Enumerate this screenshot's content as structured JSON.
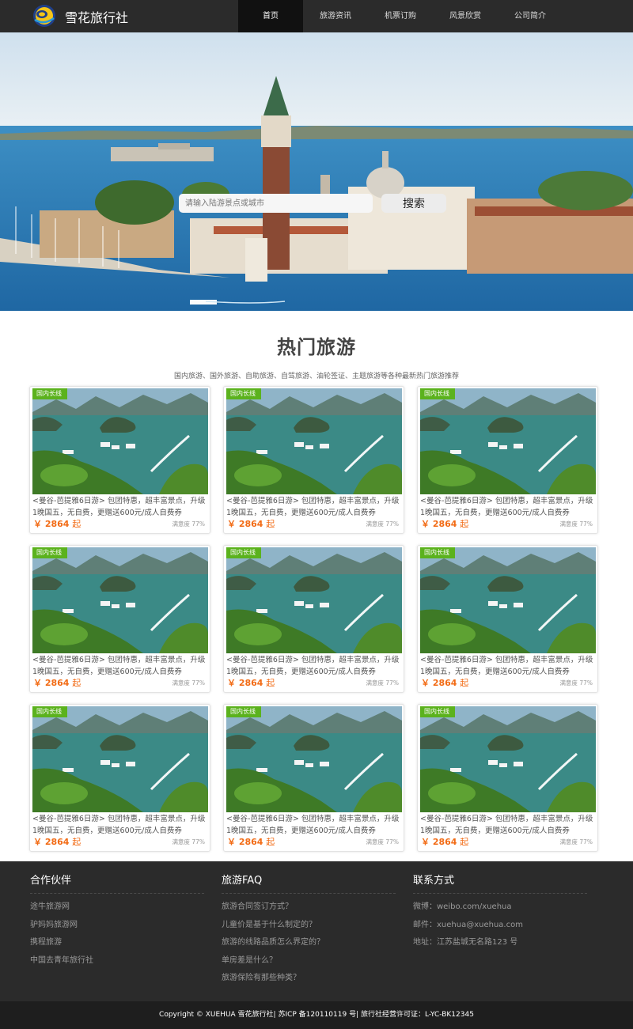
{
  "header": {
    "brand": "雪花旅行社",
    "nav": [
      "首页",
      "旅游资讯",
      "机票订购",
      "风景欣赏",
      "公司简介"
    ],
    "active_index": 0
  },
  "search": {
    "placeholder": "请输入陆游景点或城市",
    "button": "搜索"
  },
  "hot": {
    "title": "热门旅游",
    "subtitle": "国内旅游、国外旅游、自助旅游、自驾旅游、油轮签证、主题旅游等各种最新热门旅游推荐"
  },
  "tours": [
    {
      "tag": "国内长线",
      "desc": "<曼谷-芭提雅6日游> 包团特惠，超丰富景点，升级1晚国五，无自费，更赠送600元/成人自费券",
      "price": "￥ 2864",
      "unit": "起",
      "rating": "满意度 77%"
    },
    {
      "tag": "国内长线",
      "desc": "<曼谷-芭提雅6日游> 包团特惠，超丰富景点，升级1晚国五，无自费，更赠送600元/成人自费券",
      "price": "￥ 2864",
      "unit": "起",
      "rating": "满意度 77%"
    },
    {
      "tag": "国内长线",
      "desc": "<曼谷-芭提雅6日游> 包团特惠，超丰富景点，升级1晚国五，无自费，更赠送600元/成人自费券",
      "price": "￥ 2864",
      "unit": "起",
      "rating": "满意度 77%"
    },
    {
      "tag": "国内长线",
      "desc": "<曼谷-芭提雅6日游> 包团特惠，超丰富景点，升级1晚国五，无自费，更赠送600元/成人自费券",
      "price": "￥ 2864",
      "unit": "起",
      "rating": "满意度 77%"
    },
    {
      "tag": "国内长线",
      "desc": "<曼谷-芭提雅6日游> 包团特惠，超丰富景点，升级1晚国五，无自费，更赠送600元/成人自费券",
      "price": "￥ 2864",
      "unit": "起",
      "rating": "满意度 77%"
    },
    {
      "tag": "国内长线",
      "desc": "<曼谷-芭提雅6日游> 包团特惠，超丰富景点，升级1晚国五，无自费，更赠送600元/成人自费券",
      "price": "￥ 2864",
      "unit": "起",
      "rating": "满意度 77%"
    },
    {
      "tag": "国内长线",
      "desc": "<曼谷-芭提雅6日游> 包团特惠，超丰富景点，升级1晚国五，无自费，更赠送600元/成人自费券",
      "price": "￥ 2864",
      "unit": "起",
      "rating": "满意度 77%"
    },
    {
      "tag": "国内长线",
      "desc": "<曼谷-芭提雅6日游> 包团特惠，超丰富景点，升级1晚国五，无自费，更赠送600元/成人自费券",
      "price": "￥ 2864",
      "unit": "起",
      "rating": "满意度 77%"
    },
    {
      "tag": "国内长线",
      "desc": "<曼谷-芭提雅6日游> 包团特惠，超丰富景点，升级1晚国五，无自费，更赠送600元/成人自费券",
      "price": "￥ 2864",
      "unit": "起",
      "rating": "满意度 77%"
    }
  ],
  "footer": {
    "partners": {
      "title": "合作伙伴",
      "items": [
        "途牛旅游网",
        "驴妈妈旅游网",
        "携程旅游",
        "中国去青年旅行社"
      ]
    },
    "faq": {
      "title": "旅游FAQ",
      "items": [
        "旅游合同签订方式？",
        "儿童价是基于什么制定的？",
        "旅游的线路品质怎么界定的？",
        "单房差是什么？",
        "旅游保险有那些种类？"
      ]
    },
    "contact": {
      "title": "联系方式",
      "items": [
        "微博：weibo.com/xuehua",
        "邮件：xuehua@xuehua.com",
        "地址：江苏盐城无名路123 号"
      ]
    },
    "copyright": "Copyright © XUEHUA 雪花旅行社| 苏ICP 备120110119 号| 旅行社经营许可证：L-YC-BK12345"
  },
  "colors": {
    "header_bg": "#2b2b2b",
    "tag_green": "#5bb21d",
    "price_orange": "#f26b15",
    "footer_bg": "#2b2b2b"
  }
}
